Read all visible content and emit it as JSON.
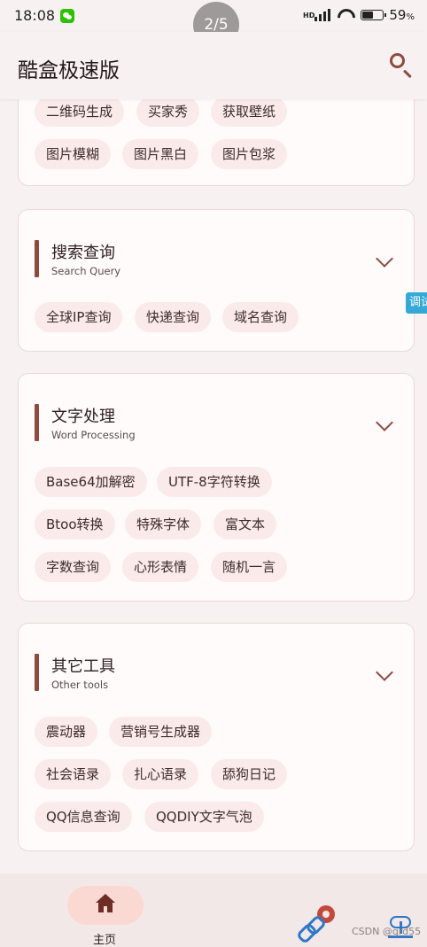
{
  "status_bar": {
    "time": "18:08",
    "battery": "59",
    "battery_unit": "%",
    "network": "HD",
    "page_indicator": "2/5"
  },
  "app_bar": {
    "title": "酷盒极速版",
    "search_icon": "search-icon"
  },
  "edge_tab": "调试",
  "sections": [
    {
      "chips": [
        "二维码生成",
        "买家秀",
        "获取壁纸",
        "图片模糊",
        "图片黑白",
        "图片包浆"
      ]
    },
    {
      "title": "搜索查询",
      "subtitle": "Search Query",
      "chips": [
        "全球IP查询",
        "快递查询",
        "域名查询"
      ]
    },
    {
      "title": "文字处理",
      "subtitle": "Word Processing",
      "chips": [
        "Base64加解密",
        "UTF-8字符转换",
        "Btoo转换",
        "特殊字体",
        "富文本",
        "字数查询",
        "心形表情",
        "随机一言"
      ]
    },
    {
      "title": "其它工具",
      "subtitle": "Other tools",
      "chips": [
        "震动器",
        "营销号生成器",
        "社会语录",
        "扎心语录",
        "舔狗日记",
        "QQ信息查询",
        "QQDIY文字气泡"
      ]
    }
  ],
  "bottom_nav": {
    "home_label": "主页"
  },
  "watermark": "CSDN @grd55"
}
